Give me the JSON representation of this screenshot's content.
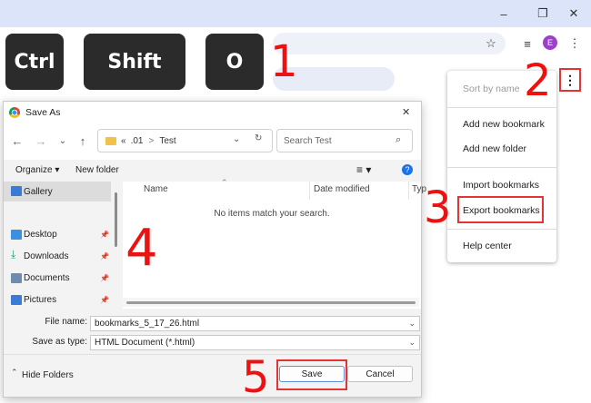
{
  "chrome": {
    "window_controls": [
      "–",
      "❐",
      "✕"
    ],
    "avatar_letter": "E"
  },
  "keys": [
    "Ctrl",
    "Shift",
    "O"
  ],
  "steps": [
    "1",
    "2",
    "3",
    "4",
    "5"
  ],
  "menu": {
    "sort_by_name": "Sort by name",
    "add_new_bookmark": "Add new bookmark",
    "add_new_folder": "Add new folder",
    "import_bookmarks": "Import bookmarks",
    "export_bookmarks": "Export bookmarks",
    "help_center": "Help center"
  },
  "dialog": {
    "title": "Save As",
    "close_glyph": "✕",
    "breadcrumb": [
      "«",
      ".01",
      ">",
      "Test"
    ],
    "search_placeholder": "Search Test",
    "organize_label": "Organize ▾",
    "new_folder_label": "New folder",
    "left_pane": {
      "gallery": "Gallery",
      "desktop": "Desktop",
      "downloads": "Downloads",
      "documents": "Documents",
      "pictures": "Pictures"
    },
    "columns": [
      "Name",
      "Date modified",
      "Typ"
    ],
    "empty_message": "No items match your search.",
    "file_name_label": "File name:",
    "file_name_value": "bookmarks_5_17_26.html",
    "save_as_type_label": "Save as type:",
    "save_as_type_value": "HTML Document (*.html)",
    "hide_folders_label": "Hide Folders",
    "save_label": "Save",
    "cancel_label": "Cancel"
  },
  "colors": {
    "accent_red": "#ee1111",
    "chrome_title_bg": "#dbe4f9",
    "avatar_purple": "#9c3fc9"
  }
}
